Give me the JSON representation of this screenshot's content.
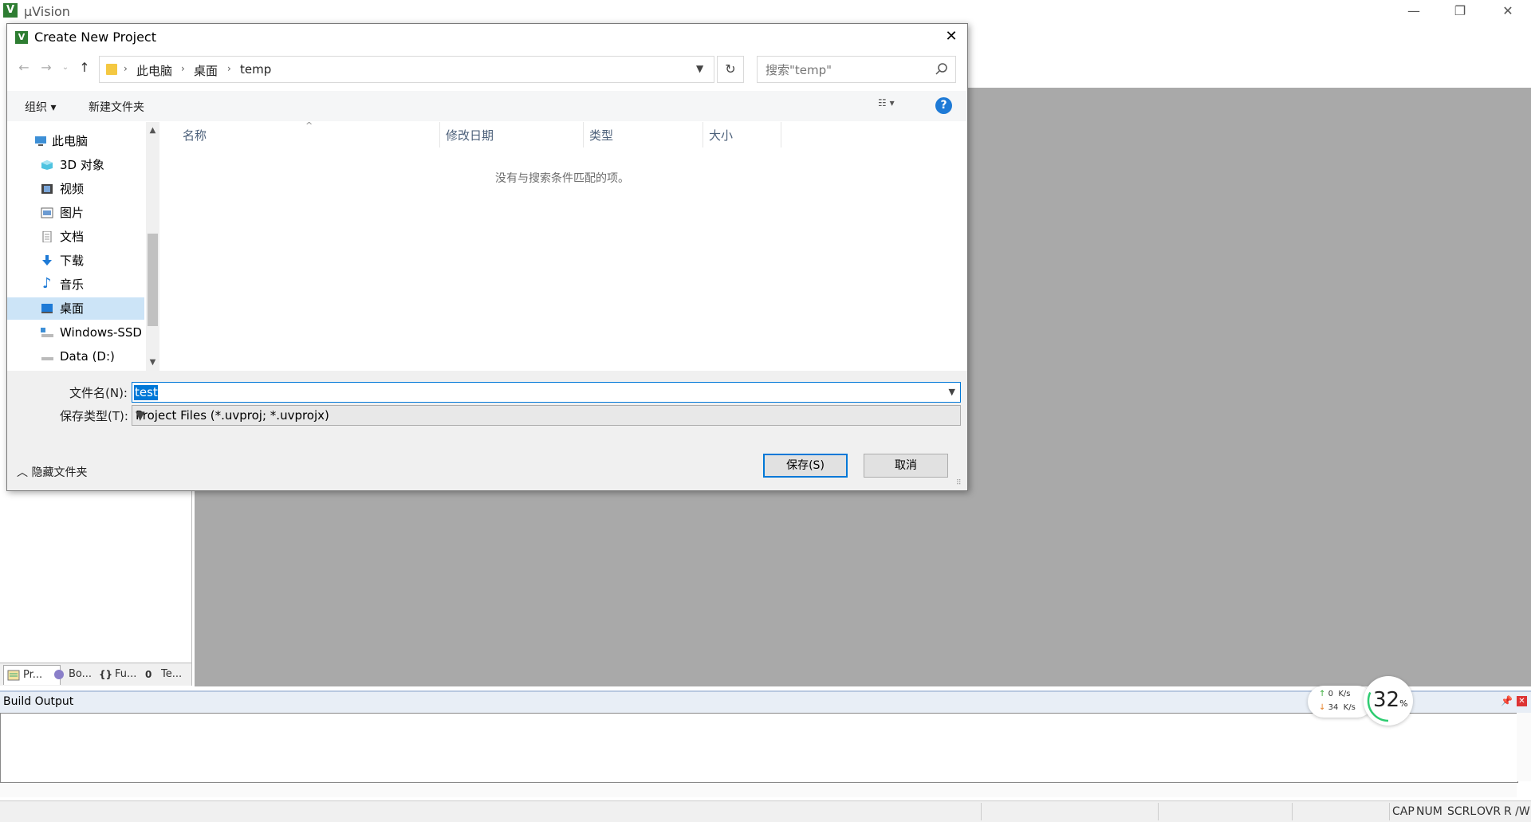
{
  "app": {
    "title": "µVision",
    "logo_text": "V",
    "minimize_glyph": "—",
    "restore_glyph": "❐",
    "close_glyph": "✕"
  },
  "dialog": {
    "title": "Create New Project",
    "close_glyph": "✕",
    "nav": {
      "back": "←",
      "forward": "→",
      "recent": "⌄",
      "up": "↑"
    },
    "breadcrumb": [
      "此电脑",
      "桌面",
      "temp"
    ],
    "breadcrumb_sep": "›",
    "refresh_glyph": "↻",
    "search_placeholder": "搜索\"temp\"",
    "commands": {
      "organize": "组织 ▾",
      "new_folder": "新建文件夹",
      "view": "☷ ▾",
      "help": "?"
    },
    "nav_items": [
      {
        "label": "此电脑",
        "icon": "computer-icon"
      },
      {
        "label": "3D 对象",
        "icon": "cube-icon"
      },
      {
        "label": "视频",
        "icon": "video-icon"
      },
      {
        "label": "图片",
        "icon": "picture-icon"
      },
      {
        "label": "文档",
        "icon": "document-icon"
      },
      {
        "label": "下载",
        "icon": "download-icon"
      },
      {
        "label": "音乐",
        "icon": "music-icon"
      },
      {
        "label": "桌面",
        "icon": "desktop-icon",
        "selected": true
      },
      {
        "label": "Windows-SSD",
        "icon": "drive-icon"
      },
      {
        "label": "Data (D:)",
        "icon": "drive-icon"
      }
    ],
    "columns": [
      "名称",
      "修改日期",
      "类型",
      "大小"
    ],
    "empty_message": "没有与搜索条件匹配的项。",
    "filename_label": "文件名(N):",
    "filename_value": "test",
    "filetype_label": "保存类型(T):",
    "filetype_value": "Project Files (*.uvproj; *.uvprojx)",
    "hide_folders": "隐藏文件夹",
    "save_button": "保存(S)",
    "cancel_button": "取消"
  },
  "panel_tabs": [
    "Pr...",
    "Bo...",
    "Fu...",
    "Te..."
  ],
  "build_output": {
    "title": "Build Output"
  },
  "status": {
    "items": [
      "CAP",
      "NUM",
      "SCRL",
      "OVR",
      "R /W"
    ]
  },
  "network_widget": {
    "upload": "0",
    "download": "34",
    "unit": "K/s",
    "cpu_value": "32",
    "cpu_unit": "%"
  },
  "colors": {
    "accent": "#0078d7",
    "workspace": "#a9a9a9",
    "selection": "#cce4f7"
  }
}
